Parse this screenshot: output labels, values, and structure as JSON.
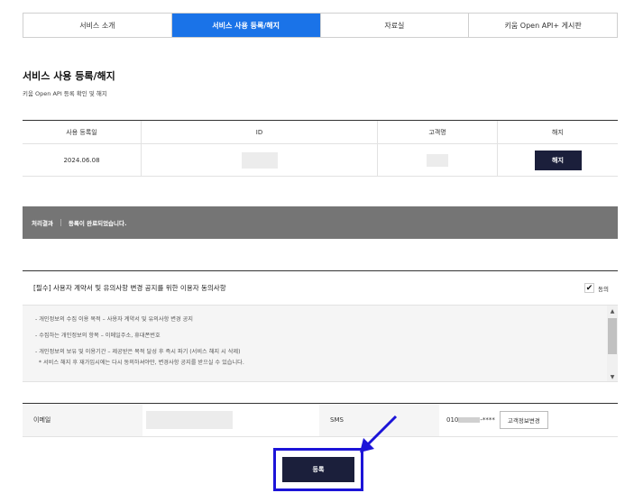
{
  "tabs": [
    {
      "label": "서비스 소개"
    },
    {
      "label": "서비스 사용 등록/해지"
    },
    {
      "label": "자료실"
    },
    {
      "label": "키움 Open API+ 게시판"
    }
  ],
  "page": {
    "title": "서비스 사용 등록/해지",
    "subtitle": "키움 Open API 등록 확인 및 해지"
  },
  "table": {
    "headers": [
      "사용 등록일",
      "ID",
      "고객명",
      "해지"
    ],
    "row": {
      "date": "2024.06.08",
      "cancel_label": "해지"
    }
  },
  "result": {
    "label": "처리결과",
    "message": "등록이 완료되었습니다."
  },
  "consent": {
    "title": "[필수] 사용자 계약서 및 유의사항 변경 공지를 위한 이용자 동의사항",
    "agree_label": "동의",
    "agree_checked": true,
    "lines": [
      "- 개인정보의 수집 이용 목적 – 사용자 계약서 및 유의사항 변경 공지",
      "- 수집하는 개인정보의 항목 – 이메일주소, 휴대폰번호",
      "- 개인정보의 보유 및 이용기간 – 제공받은 목적 달성 후 즉시 파기 (서비스 해지 시 삭제)",
      "  * 서비스 해지 후 재가입시에는 다시 동의하셔야만, 변경사항 공지를 받으실 수 있습니다."
    ],
    "scroll_up": "▲",
    "scroll_down": "▼"
  },
  "contact": {
    "email_label": "이메일",
    "sms_label": "SMS",
    "phone_prefix": "010",
    "phone_suffix": "-****",
    "change_button": "고객정보변경"
  },
  "submit": {
    "label": "등록"
  },
  "colors": {
    "accent": "#1a73e8",
    "dark_button": "#1b1f3b",
    "result_bar": "#757575",
    "highlight": "#1c14d8"
  }
}
